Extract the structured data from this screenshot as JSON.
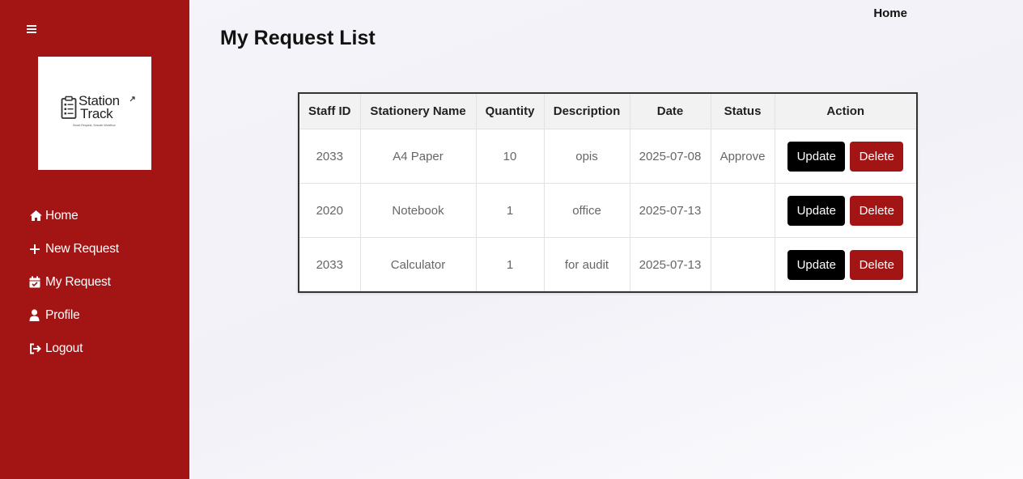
{
  "sidebar": {
    "logo": {
      "line1": "Station",
      "line2": "Track",
      "tagline": "Smart Request, Smooth Workflow"
    },
    "items": [
      {
        "label": "Home",
        "icon": "home-icon"
      },
      {
        "label": "New Request",
        "icon": "plus-icon"
      },
      {
        "label": "My Request",
        "icon": "calendar-check-icon"
      },
      {
        "label": "Profile",
        "icon": "user-icon"
      },
      {
        "label": "Logout",
        "icon": "logout-icon"
      }
    ]
  },
  "header": {
    "home_link": "Home"
  },
  "main": {
    "title": "My Request List",
    "table": {
      "columns": [
        "Staff ID",
        "Stationery Name",
        "Quantity",
        "Description",
        "Date",
        "Status",
        "Action"
      ],
      "rows": [
        {
          "staff_id": "2033",
          "name": "A4 Paper",
          "quantity": "10",
          "description": "opis",
          "date": "2025-07-08",
          "status": "Approve",
          "update": "Update",
          "delete": "Delete"
        },
        {
          "staff_id": "2020",
          "name": "Notebook",
          "quantity": "1",
          "description": "office",
          "date": "2025-07-13",
          "status": "",
          "update": "Update",
          "delete": "Delete"
        },
        {
          "staff_id": "2033",
          "name": "Calculator",
          "quantity": "1",
          "description": "for audit",
          "date": "2025-07-13",
          "status": "",
          "update": "Update",
          "delete": "Delete"
        }
      ]
    }
  },
  "colors": {
    "sidebar": "#a31515",
    "update_button": "#000000",
    "delete_button": "#a31515"
  }
}
